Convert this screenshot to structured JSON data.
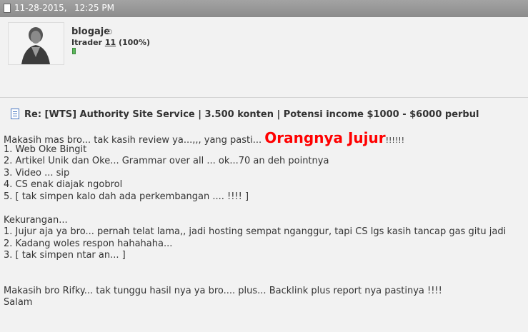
{
  "header": {
    "date": "11-28-2015,",
    "time": "12:25 PM"
  },
  "user": {
    "username": "blogaje",
    "rank_label": "Itrader",
    "rank_count": "11",
    "rank_percent": "(100%)"
  },
  "post": {
    "title": "Re: [WTS] Authority Site Service | 3.500 konten | Potensi income $1000 - $6000 perbul",
    "intro": "Makasih mas bro... tak kasih review ya...,,, yang pasti...",
    "highlight": "Orangnya Jujur",
    "highlight_suffix": "!!!!!!",
    "pros": [
      "1. Web Oke Bingit",
      "2. Artikel Unik dan Oke... Grammar over all ... ok...70 an deh pointnya",
      "3. Video ... sip",
      "4. CS enak diajak ngobrol",
      "5. [ tak simpen kalo dah ada perkembangan .... !!!! ]"
    ],
    "cons_heading": "Kekurangan...",
    "cons": [
      "1. Jujur aja ya bro... pernah telat lama,, jadi hosting sempat nganggur, tapi CS lgs kasih tancap gas gitu jadi",
      "2. Kadang woles respon hahahaha...",
      "3. [ tak simpen ntar an... ]"
    ],
    "closing": "Makasih bro Rifky... tak tunggu hasil nya ya bro.... plus... Backlink plus report nya pastinya !!!!",
    "signoff": "Salam"
  }
}
